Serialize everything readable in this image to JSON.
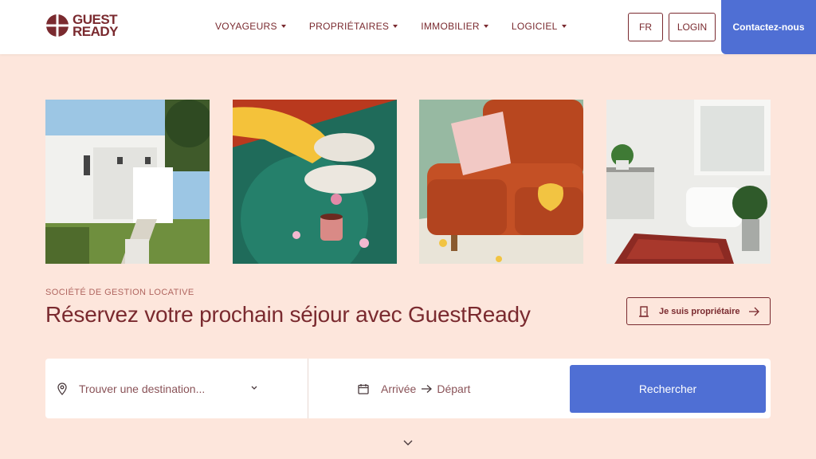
{
  "brand": {
    "logo_text_line1": "GUEST",
    "logo_text_line2": "READY",
    "color": "#7a2a2f"
  },
  "nav": {
    "items": [
      {
        "label": "VOYAGEURS"
      },
      {
        "label": "PROPRIÉTAIRES"
      },
      {
        "label": "IMMOBILIER"
      },
      {
        "label": "LOGICIEL"
      }
    ],
    "language_label": "FR",
    "login_label": "LOGIN",
    "contact_label": "Contactez-nous",
    "accent": "#4f6fd4"
  },
  "gallery": {
    "images": [
      {
        "icon": "white-villa-photo"
      },
      {
        "icon": "slippers-and-mug-photo"
      },
      {
        "icon": "orange-sofa-photo"
      },
      {
        "icon": "bathroom-photo"
      }
    ]
  },
  "hero": {
    "eyebrow": "SOCIÉTÉ DE GESTION LOCATIVE",
    "title": "Réservez votre prochain séjour avec GuestReady",
    "owner_button_label": "Je suis propriétaire"
  },
  "search": {
    "destination_placeholder": "Trouver une destination...",
    "arrival_label": "Arrivée",
    "departure_label": "Départ",
    "button_label": "Rechercher"
  },
  "colors": {
    "background": "#fde6dc",
    "text": "#7a2a2f",
    "button": "#4f6fd4"
  }
}
